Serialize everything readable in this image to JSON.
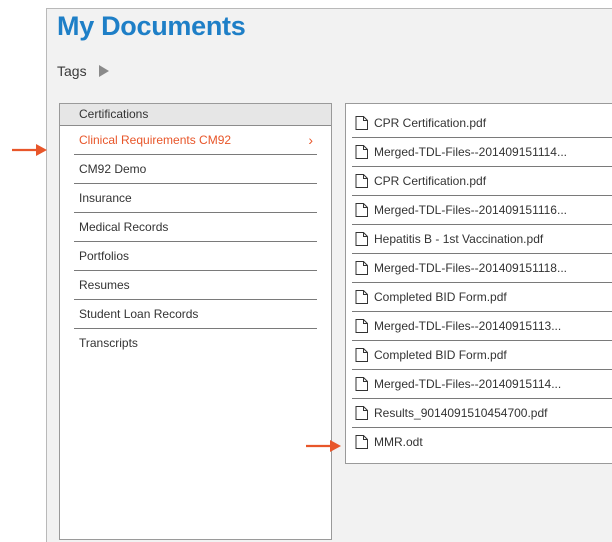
{
  "title": "My Documents",
  "tags_label": "Tags",
  "folders": {
    "header": "Certifications",
    "items": [
      {
        "label": "Clinical Requirements CM92",
        "selected": true
      },
      {
        "label": "CM92 Demo"
      },
      {
        "label": "Insurance"
      },
      {
        "label": "Medical Records"
      },
      {
        "label": "Portfolios"
      },
      {
        "label": "Resumes"
      },
      {
        "label": "Student Loan Records"
      },
      {
        "label": "Transcripts"
      }
    ],
    "chevron": "›"
  },
  "files": [
    "CPR Certification.pdf",
    "Merged-TDL-Files--201409151114...",
    "CPR Certification.pdf",
    "Merged-TDL-Files--201409151116...",
    "Hepatitis B - 1st Vaccination.pdf",
    "Merged-TDL-Files--201409151118...",
    "Completed BID Form.pdf",
    "Merged-TDL-Files--20140915113...",
    "Completed BID Form.pdf",
    "Merged-TDL-Files--20140915114...",
    "Results_9014091510454700.pdf",
    "MMR.odt"
  ],
  "colors": {
    "title": "#1e7fc7",
    "selected": "#e8562a",
    "arrow": "#e8562a"
  },
  "icons": {
    "file": "document-icon",
    "tags": "play-triangle-icon",
    "pointer": "arrow-right-icon"
  }
}
